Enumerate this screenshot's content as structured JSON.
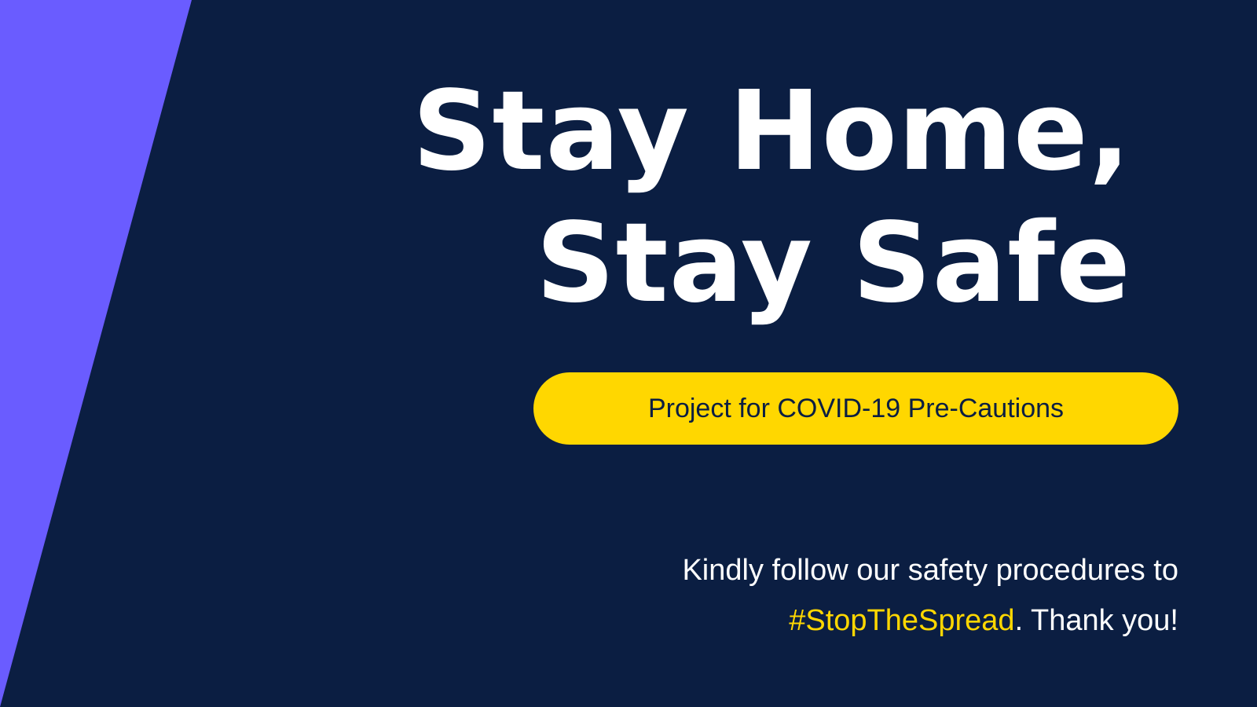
{
  "colors": {
    "background": "#0b1e42",
    "accent": "#6a5cff",
    "highlight": "#ffd700",
    "text": "#ffffff"
  },
  "headline": {
    "line1": "Stay Home,",
    "line2": "Stay Safe"
  },
  "pill": {
    "label": "Project for COVID-19 Pre-Cautions"
  },
  "message": {
    "line1": "Kindly follow our safety procedures to",
    "hashtag": "#StopTheSpread",
    "line2_suffix": ". Thank you!"
  }
}
